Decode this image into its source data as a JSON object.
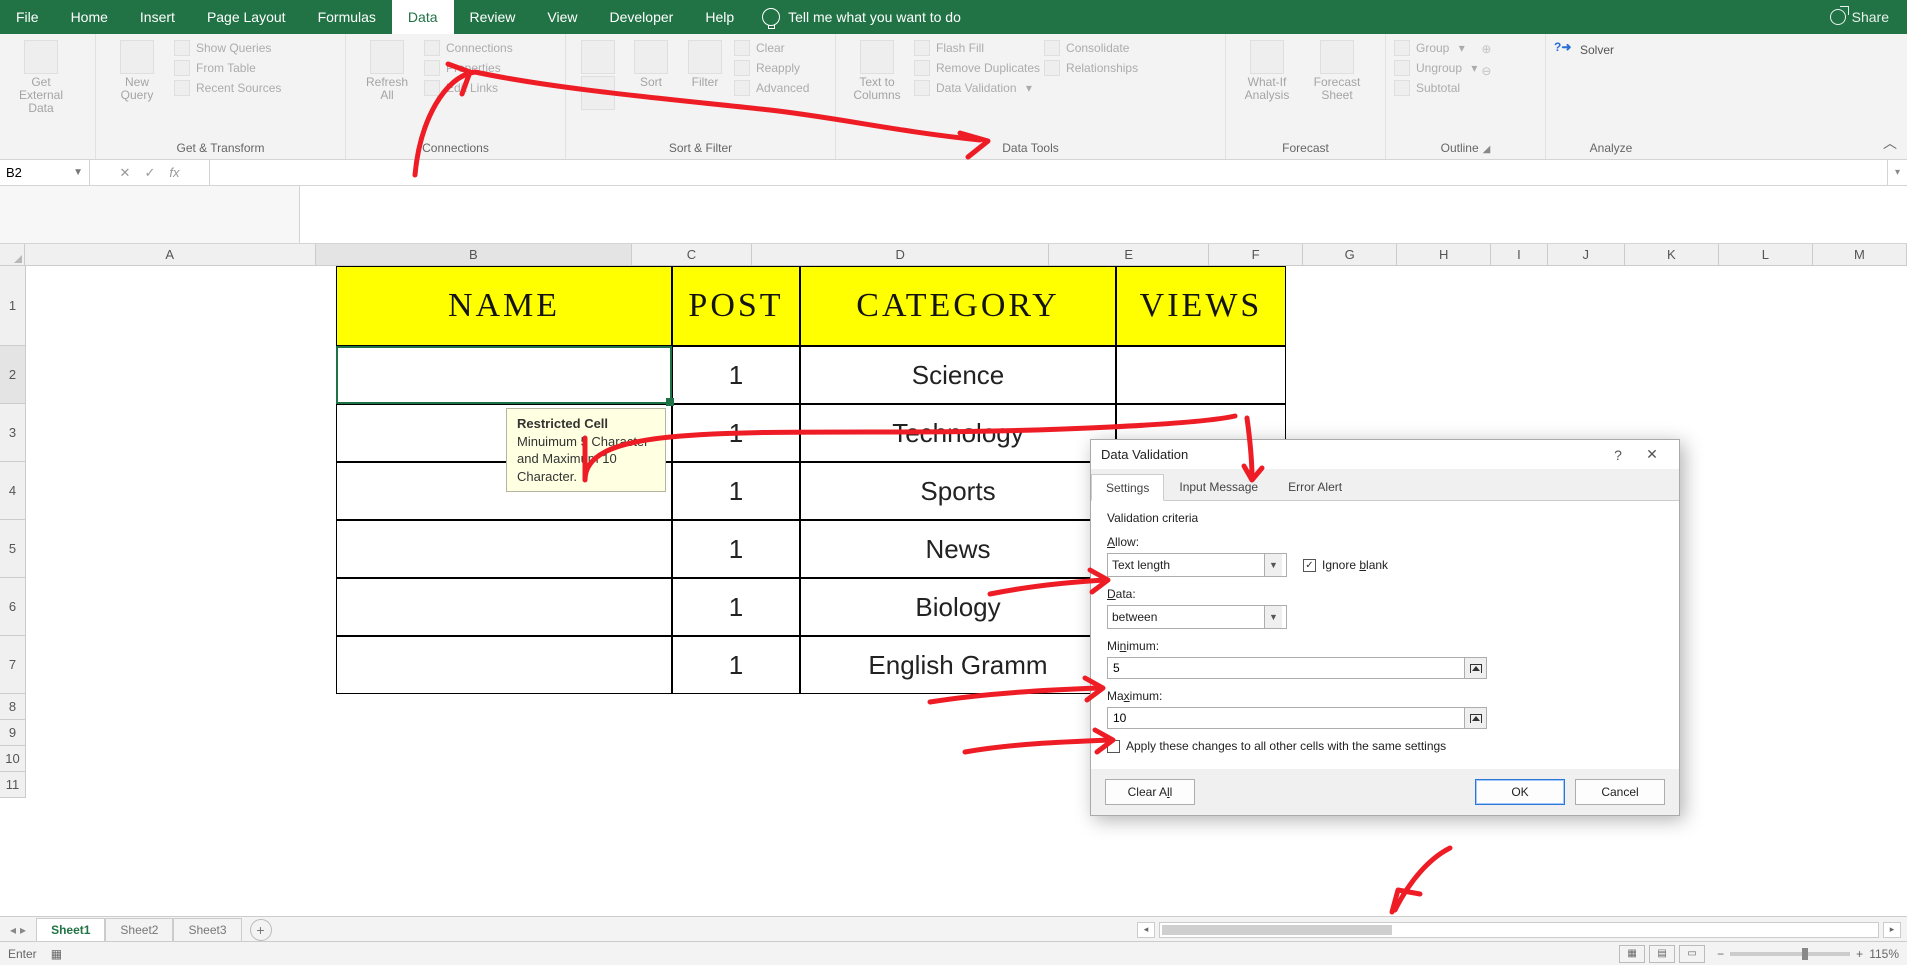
{
  "tabs": {
    "file": "File",
    "home": "Home",
    "insert": "Insert",
    "pagelayout": "Page Layout",
    "formulas": "Formulas",
    "data": "Data",
    "review": "Review",
    "view": "View",
    "developer": "Developer",
    "help": "Help",
    "tell": "Tell me what you want to do",
    "share": "Share"
  },
  "ribbon": {
    "getexternal": {
      "big": "Get External\nData",
      "label": "Get & Transform"
    },
    "newquery": "New\nQuery",
    "gq": {
      "a": "Show Queries",
      "b": "From Table",
      "c": "Recent Sources"
    },
    "refresh": "Refresh\nAll",
    "conn": {
      "a": "Connections",
      "b": "Properties",
      "c": "Edit Links",
      "label": "Connections"
    },
    "sort": "Sort",
    "filter": "Filter",
    "sf": {
      "a": "Clear",
      "b": "Reapply",
      "c": "Advanced",
      "label": "Sort & Filter"
    },
    "ttc": "Text to\nColumns",
    "dt": {
      "a": "Flash Fill",
      "b": "Remove Duplicates",
      "c": "Data Validation",
      "d": "Consolidate",
      "e": "Relationships",
      "label": "Data Tools"
    },
    "wia": "What-If\nAnalysis",
    "fs": "Forecast\nSheet",
    "fc": {
      "label": "Forecast"
    },
    "ol": {
      "a": "Group",
      "b": "Ungroup",
      "c": "Subtotal",
      "label": "Outline"
    },
    "solver": "Solver",
    "an": {
      "label": "Analyze"
    }
  },
  "fbar": {
    "name": "B2",
    "fx": "fx"
  },
  "cols": [
    "A",
    "B",
    "C",
    "D",
    "E",
    "F",
    "G",
    "H",
    "I",
    "J",
    "K",
    "L",
    "M"
  ],
  "rownums": [
    "1",
    "2",
    "3",
    "4",
    "5",
    "6",
    "7",
    "8",
    "9",
    "10",
    "11"
  ],
  "rowH": {
    "1": 80,
    "2": 58,
    "3": 58,
    "4": 58,
    "5": 58,
    "6": 58,
    "7": 58,
    "8": 26,
    "9": 26,
    "10": 26,
    "11": 26
  },
  "headers": {
    "b": "NAME",
    "c": "POST",
    "d": "CATEGORY",
    "e": "VIEWS"
  },
  "data": {
    "posts": [
      "1",
      "1",
      "1",
      "1",
      "1",
      "1"
    ],
    "cats": [
      "Science",
      "Technology",
      "Sports",
      "News",
      "Biology",
      "English Gramm"
    ]
  },
  "tooltip": {
    "title": "Restricted Cell",
    "body": "Minuimum 5 Character and Maximum 10 Character."
  },
  "dialog": {
    "title": "Data Validation",
    "tabs": {
      "a": "Settings",
      "b": "Input Message",
      "c": "Error Alert"
    },
    "criteria": "Validation criteria",
    "allow_lbl": "Allow:",
    "allow_val": "Text length",
    "ignore": "Ignore blank",
    "data_lbl": "Data:",
    "data_val": "between",
    "min_lbl": "Minimum:",
    "min_val": "5",
    "max_lbl": "Maximum:",
    "max_val": "10",
    "apply": "Apply these changes to all other cells with the same settings",
    "clear": "Clear All",
    "ok": "OK",
    "cancel": "Cancel"
  },
  "sheets": {
    "s1": "Sheet1",
    "s2": "Sheet2",
    "s3": "Sheet3"
  },
  "status": {
    "mode": "Enter",
    "zoom": "115%"
  }
}
